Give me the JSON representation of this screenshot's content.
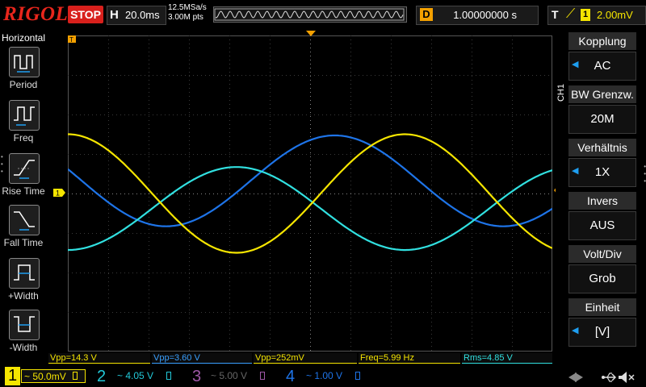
{
  "header": {
    "brand": "RIGOL",
    "run_state": "STOP",
    "h_letter": "H",
    "timebase": "20.0ms",
    "sample_rate": "12.5MSa/s",
    "memory_depth": "3.00M pts",
    "d_letter": "D",
    "delay": "1.00000000 s",
    "t_letter": "T",
    "trigger_channel": "1",
    "trigger_level": "2.00mV"
  },
  "left_menu": {
    "title": "Horizontal",
    "items": [
      {
        "label": "Period"
      },
      {
        "label": "Freq"
      },
      {
        "label": "Rise Time"
      },
      {
        "label": "Fall Time"
      },
      {
        "label": "+Width"
      },
      {
        "label": "-Width"
      }
    ]
  },
  "right_menu": {
    "channel_tab": "CH1",
    "items": [
      {
        "title": "Kopplung",
        "value": "AC"
      },
      {
        "title": "BW Grenzw.",
        "value": "20M"
      },
      {
        "title": "Verhältnis",
        "value": "1X"
      },
      {
        "title": "Invers",
        "value": "AUS"
      },
      {
        "title": "Volt/Div",
        "value": "Grob"
      },
      {
        "title": "Einheit",
        "value": "[V]"
      }
    ]
  },
  "measurements": [
    {
      "text": "Vpp=14.3 V",
      "color": "#f5e500"
    },
    {
      "text": "Vpp=3.60 V",
      "color": "#3aa0ff"
    },
    {
      "text": "Vpp=252mV",
      "color": "#f5e500"
    },
    {
      "text": "Freq=5.99 Hz",
      "color": "#f5e500"
    },
    {
      "text": "Rms=4.85 V",
      "color": "#31e0e0"
    }
  ],
  "channels": [
    {
      "num": "1",
      "scale": "~ 50.0mV",
      "color": "#f5e500"
    },
    {
      "num": "2",
      "scale": "~ 4.05 V",
      "color": "#22c8d8"
    },
    {
      "num": "3",
      "scale": "~ 5.00 V",
      "color": "#a058a8"
    },
    {
      "num": "4",
      "scale": "~ 1.00 V",
      "color": "#1e74e8"
    }
  ],
  "waveforms": {
    "ch1": {
      "color": "#f5e500",
      "amplitude_div": 1.5,
      "offset_div": 0.0,
      "phase_deg": 90
    },
    "ch2": {
      "color": "#31e0e0",
      "amplitude_div": 1.05,
      "offset_div": -0.38,
      "phase_deg": -90
    },
    "ch4": {
      "color": "#1e74e8",
      "amplitude_div": 1.15,
      "offset_div": 0.32,
      "phase_deg": 165
    },
    "period_div": 8.35
  },
  "colors": {
    "accent": "#1e9ef0",
    "trigger_marker": "#f3a000",
    "grid": "#3a3a3a"
  }
}
